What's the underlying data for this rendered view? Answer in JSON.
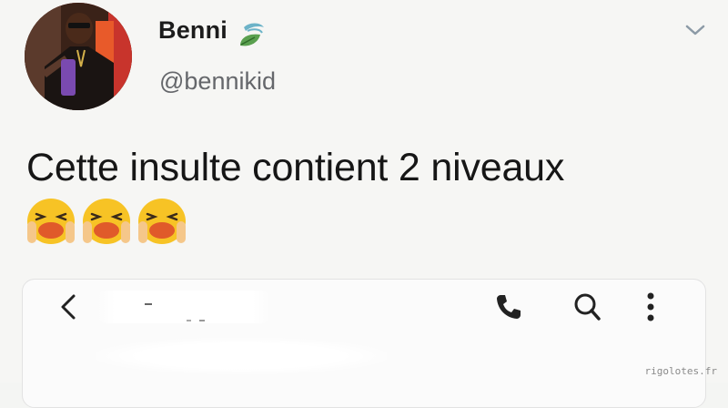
{
  "tweet": {
    "user": {
      "name": "Benni",
      "handle": "@bennikid"
    },
    "text": "Cette insulte contient 2 niveaux",
    "emoji_count": 3,
    "emoji_name": "loudly-crying-face"
  },
  "embedded_screenshot": {
    "toolbar_icons": [
      "back-icon",
      "phone-icon",
      "search-icon",
      "more-icon"
    ]
  },
  "watermark": "rigolotes.fr",
  "colors": {
    "handle": "#65676b",
    "emoji_face": "#f7c325",
    "emoji_mouth": "#e05a2a",
    "verified_badge_leaf": "#5aa04f"
  }
}
